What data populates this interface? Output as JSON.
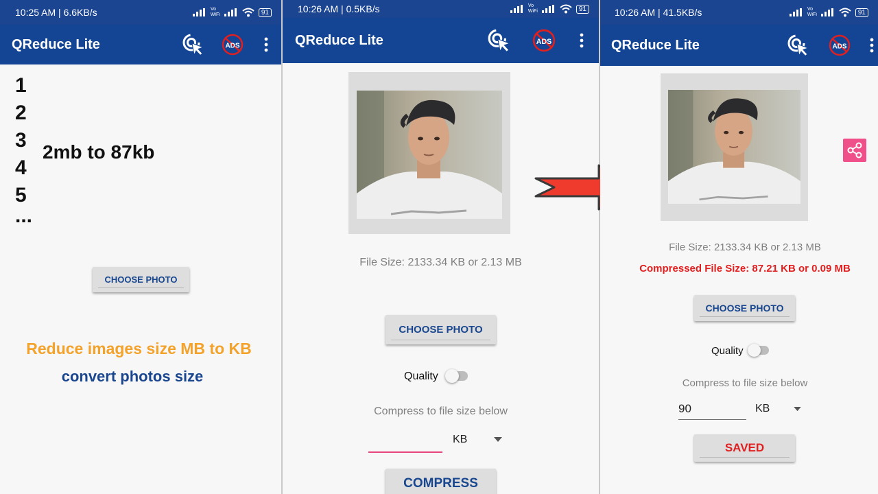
{
  "status": {
    "p1_time": "10:25 AM | 6.6KB/s",
    "p2_time": "10:26 AM | 0.5KB/s",
    "p3_time": "10:26 AM | 41.5KB/s",
    "battery": "91",
    "vowifi": "Vo WiFi",
    "alarm_icon": "alarm-icon",
    "signal_icon": "signal-bars-icon",
    "wifi_icon": "wifi-icon"
  },
  "app": {
    "title": "QReduce Lite",
    "ads_label": "ADS",
    "click_icon": "cursor-click-icon",
    "noads_icon": "no-ads-icon",
    "menu_icon": "more-vert-icon",
    "bar_color": "#134594",
    "accent": "#1a4690"
  },
  "panel1": {
    "list": [
      "1",
      "2",
      "3",
      "4",
      "5",
      "..."
    ],
    "headline": "2mb to 87kb",
    "choose_btn": "CHOOSE PHOTO",
    "promo_line1": "Reduce images size MB to KB",
    "promo_line2": "convert photos size",
    "promo_color1": "#f3a22b",
    "promo_color2": "#1a4690"
  },
  "panel2": {
    "file_size": "File Size: 2133.34 KB or 2.13 MB",
    "choose_btn": "CHOOSE PHOTO",
    "quality_label": "Quality",
    "quality_on": false,
    "compress_label": "Compress to file size below",
    "size_input": "",
    "unit": "KB",
    "compress_btn": "COMPRESS",
    "input_underline_color": "#e8457a"
  },
  "panel3": {
    "file_size": "File Size: 2133.34 KB or 2.13 MB",
    "compressed_size": "Compressed File Size: 87.21 KB or 0.09 MB",
    "compressed_color": "#e02020",
    "choose_btn": "CHOOSE PHOTO",
    "quality_label": "Quality",
    "quality_on": false,
    "compress_label": "Compress to file size below",
    "size_input": "90",
    "unit": "KB",
    "saved_btn": "SAVED",
    "saved_color": "#e02020",
    "share_icon": "share-icon",
    "share_color": "#f0508a"
  },
  "arrow": {
    "icon": "right-arrow-icon",
    "color": "#ef3b2d"
  }
}
